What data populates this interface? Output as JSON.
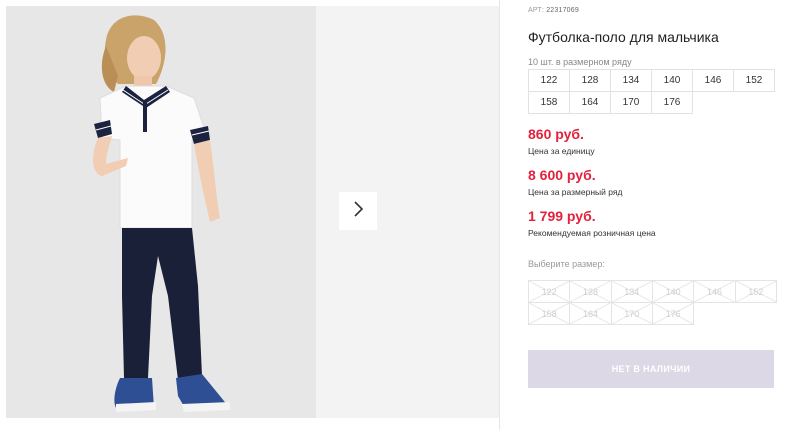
{
  "product": {
    "article_label": "АРТ:",
    "article_number": "22317069",
    "title": "Футболка-поло для мальчика",
    "sizes_in_row": "10 шт. в размерном ряду",
    "sizes": [
      "122",
      "128",
      "134",
      "140",
      "146",
      "152",
      "158",
      "164",
      "170",
      "176"
    ],
    "prices": [
      {
        "value": "860 руб.",
        "label": "Цена за единицу"
      },
      {
        "value": "8 600 руб.",
        "label": "Цена за размерный ряд"
      },
      {
        "value": "1 799 руб.",
        "label": "Рекомендуемая розничная цена"
      }
    ],
    "choose_size_label": "Выберите размер:",
    "choose_sizes": [
      "122",
      "128",
      "134",
      "140",
      "146",
      "152",
      "158",
      "164",
      "170",
      "176"
    ],
    "out_of_stock_label": "НЕТ В НАЛИЧИИ"
  },
  "colors": {
    "price": "#e2223b",
    "disabled_button": "#dcd8e5",
    "photo_bg": "#e7e7e7"
  },
  "icons": {
    "next": "chevron-right-icon"
  }
}
